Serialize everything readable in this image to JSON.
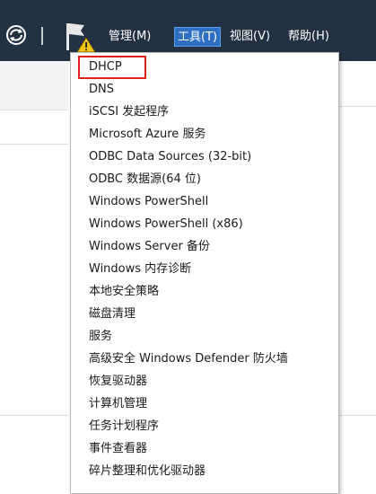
{
  "menubar": {
    "items": [
      {
        "label": "管理(M)",
        "active": false
      },
      {
        "label": "工具(T)",
        "active": true
      },
      {
        "label": "视图(V)",
        "active": false
      },
      {
        "label": "帮助(H)",
        "active": false
      }
    ]
  },
  "tools_menu": {
    "items": [
      {
        "label": "DHCP"
      },
      {
        "label": "DNS"
      },
      {
        "label": "iSCSI 发起程序"
      },
      {
        "label": "Microsoft Azure 服务"
      },
      {
        "label": "ODBC Data Sources (32-bit)"
      },
      {
        "label": "ODBC 数据源(64 位)"
      },
      {
        "label": "Windows PowerShell"
      },
      {
        "label": "Windows PowerShell (x86)"
      },
      {
        "label": "Windows Server 备份"
      },
      {
        "label": "Windows 内存诊断"
      },
      {
        "label": "本地安全策略"
      },
      {
        "label": "磁盘清理"
      },
      {
        "label": "服务"
      },
      {
        "label": "高级安全 Windows Defender 防火墙"
      },
      {
        "label": "恢复驱动器"
      },
      {
        "label": "计算机管理"
      },
      {
        "label": "任务计划程序"
      },
      {
        "label": "事件查看器"
      },
      {
        "label": "碎片整理和优化驱动器"
      }
    ],
    "highlighted_item": "DHCP"
  },
  "colors": {
    "titlebar_bg": "#233242",
    "active_menu_bg": "#2d6fc3",
    "highlight_border": "#e0201b",
    "warning_triangle": "#f5c518"
  },
  "icons": {
    "refresh": "refresh-icon",
    "flag": "flag-icon",
    "warning": "warning-icon"
  }
}
